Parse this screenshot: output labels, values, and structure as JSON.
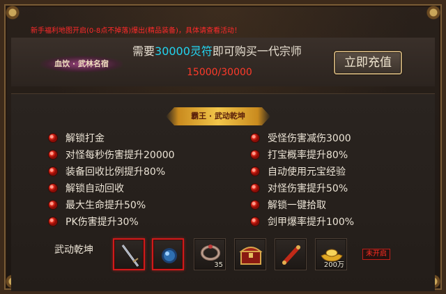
{
  "announcement": "新手福利地图开启(0-8点不掉落)爆出(精品装备)，具体请查看活动！",
  "rank_badge": "血饮 · 武林名宿",
  "purchase": {
    "prefix": "需要",
    "amount": "30000灵符",
    "suffix": "即可购买一代宗师",
    "progress": "15000/30000"
  },
  "recharge_button": "立即充值",
  "section_title": "霸王 · 武动乾坤",
  "attributes_left": [
    "解锁打金",
    "对怪每秒伤害提升20000",
    "装备回收比例提升80%",
    "解锁自动回收",
    "最大生命提升50%",
    "PK伤害提升30%"
  ],
  "attributes_right": [
    "受怪伤害减伤3000",
    "打宝概率提升80%",
    "自动使用元宝经验",
    "对怪伤害提升50%",
    "解锁一键拾取",
    "剑甲爆率提升100%"
  ],
  "items_label": "武动乾坤",
  "items": [
    {
      "icon": "sword-icon",
      "count": "",
      "highlighted": true
    },
    {
      "icon": "blue-orb-icon",
      "count": "",
      "highlighted": true
    },
    {
      "icon": "ring-icon",
      "count": "35",
      "highlighted": false
    },
    {
      "icon": "treasure-chest-icon",
      "count": "",
      "highlighted": false
    },
    {
      "icon": "scroll-icon",
      "count": "",
      "highlighted": false
    },
    {
      "icon": "gold-ingot-icon",
      "count": "200万",
      "highlighted": false
    }
  ],
  "status_tag": "未开启",
  "colors": {
    "cyan_highlight": "#22d4f0",
    "red_text": "#ff3a2a",
    "gold_banner": "#f2c64a"
  }
}
